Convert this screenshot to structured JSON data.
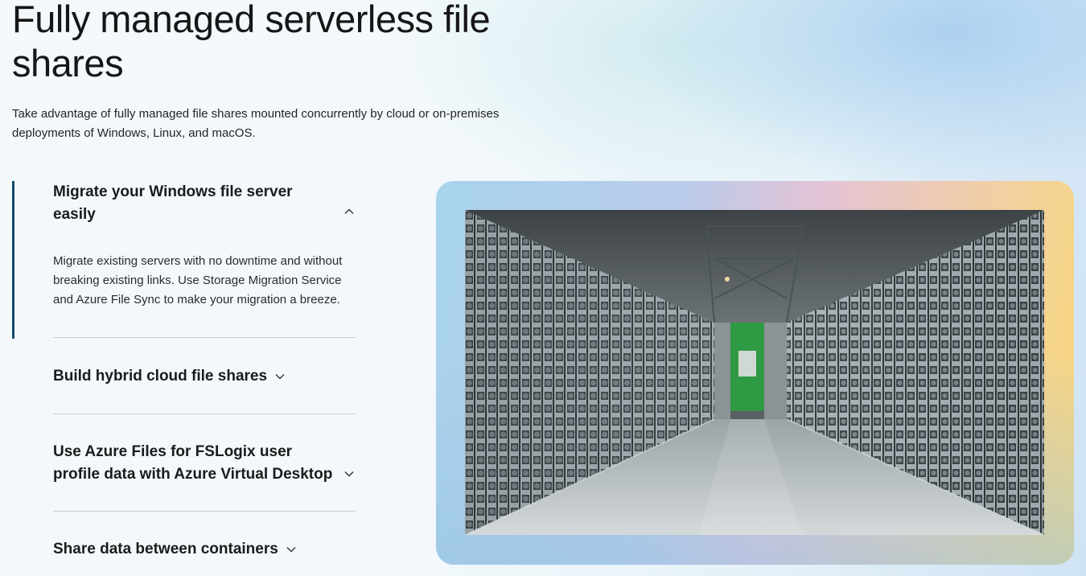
{
  "hero": {
    "title": "Fully managed serverless file shares",
    "subtitle": "Take advantage of fully managed file shares mounted concurrently by cloud or on-premises deployments of Windows, Linux, and macOS."
  },
  "accordion": {
    "items": [
      {
        "title": "Migrate your Windows file server easily",
        "expanded": true,
        "icon": "chevron-up-icon",
        "body": "Migrate existing servers with no downtime and without breaking existing links. Use Storage Migration Service and Azure File Sync to make your migration a breeze."
      },
      {
        "title": "Build hybrid cloud file shares",
        "expanded": false,
        "icon": "chevron-down-icon"
      },
      {
        "title": "Use Azure Files for FSLogix user profile data with Azure Virtual Desktop",
        "expanded": false,
        "icon": "chevron-down-icon"
      },
      {
        "title": "Share data between containers",
        "expanded": false,
        "icon": "chevron-down-icon"
      }
    ]
  },
  "media": {
    "subject": "datacenter-server-aisle-photo"
  },
  "colors": {
    "active_indicator": "#0f4c6e",
    "divider": "#c8cfd4",
    "door_green": "#2f9a44"
  }
}
